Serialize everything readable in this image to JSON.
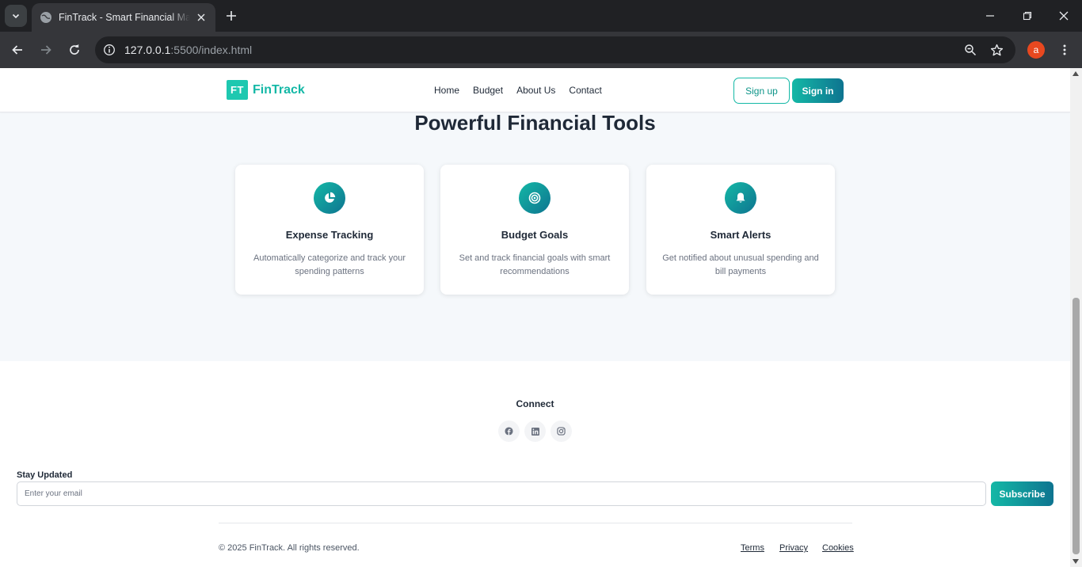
{
  "browser": {
    "tab_title": "FinTrack - Smart Financial Management",
    "url_host": "127.0.0.1",
    "url_rest": ":5500/index.html",
    "profile_initial": "a"
  },
  "header": {
    "logo_mark": "FT",
    "logo_text": "FinTrack",
    "nav": [
      "Home",
      "Budget",
      "About Us",
      "Contact"
    ],
    "signup_label": "Sign up",
    "signin_label": "Sign in"
  },
  "features": {
    "title": "Powerful Financial Tools",
    "cards": [
      {
        "icon": "pie-chart-icon",
        "title": "Expense Tracking",
        "description": "Automatically categorize and track your spending patterns"
      },
      {
        "icon": "target-icon",
        "title": "Budget Goals",
        "description": "Set and track financial goals with smart recommendations"
      },
      {
        "icon": "bell-icon",
        "title": "Smart Alerts",
        "description": "Get notified about unusual spending and bill payments"
      }
    ]
  },
  "footer": {
    "connect_title": "Connect",
    "social": [
      "facebook-icon",
      "linkedin-icon",
      "instagram-icon"
    ],
    "stay_updated_label": "Stay Updated",
    "email_placeholder": "Enter your email",
    "subscribe_label": "Subscribe",
    "copyright": "© 2025 FinTrack. All rights reserved.",
    "legal_links": [
      "Terms",
      "Privacy",
      "Cookies"
    ]
  },
  "colors": {
    "brand": "#14b8a6",
    "brand_dark": "#0e7490",
    "section_bg": "#f5f8fb"
  }
}
